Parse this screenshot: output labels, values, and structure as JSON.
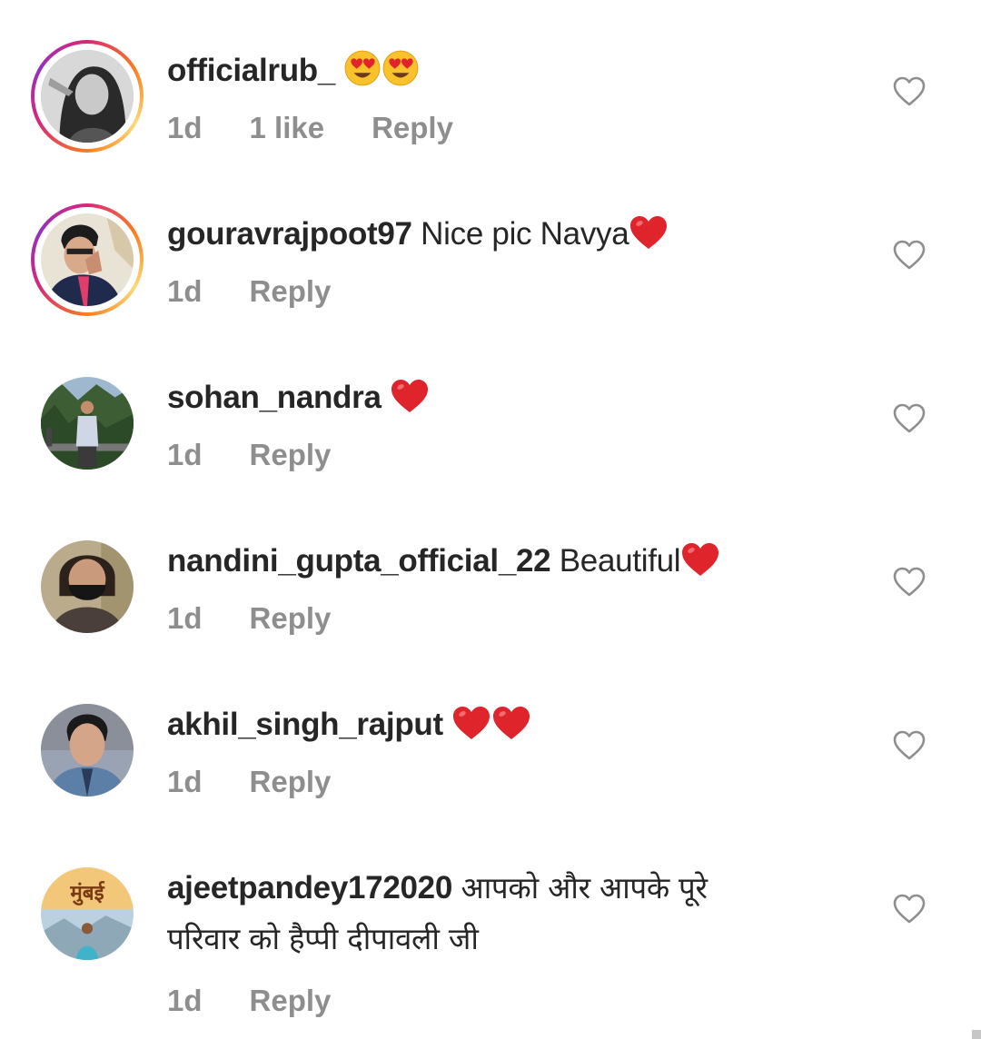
{
  "comments": [
    {
      "username": "officialrub_",
      "text": "",
      "emojis": [
        "heart-eyes",
        "heart-eyes"
      ],
      "time": "1d",
      "likes": "1 like",
      "reply": "Reply",
      "has_story_ring": true
    },
    {
      "username": "gouravrajpoot97",
      "text": "Nice pic Navya",
      "emojis": [
        "red-heart"
      ],
      "time": "1d",
      "likes": "",
      "reply": "Reply",
      "has_story_ring": true
    },
    {
      "username": "sohan_nandra",
      "text": "",
      "emojis": [
        "red-heart"
      ],
      "time": "1d",
      "likes": "",
      "reply": "Reply",
      "has_story_ring": false
    },
    {
      "username": "nandini_gupta_official_22",
      "text": "Beautiful",
      "emojis": [
        "red-heart"
      ],
      "time": "1d",
      "likes": "",
      "reply": "Reply",
      "has_story_ring": false
    },
    {
      "username": "akhil_singh_rajput",
      "text": "",
      "emojis": [
        "red-heart",
        "red-heart"
      ],
      "time": "1d",
      "likes": "",
      "reply": "Reply",
      "has_story_ring": false
    },
    {
      "username": "ajeetpandey172020",
      "text": "आपको और आपके पूरे",
      "text_line2": "परिवार को हैप्पी दीपावली जी",
      "emojis": [],
      "time": "1d",
      "likes": "",
      "reply": "Reply",
      "has_story_ring": false,
      "avatar_caption": "मुंबई"
    }
  ],
  "colors": {
    "text": "#262626",
    "meta": "#8e8e8e",
    "heart_outline": "#8e8e8e",
    "emoji_red": "#e0242b"
  },
  "icons": {
    "like_button": "heart-outline-icon",
    "red_heart": "red-heart-emoji",
    "heart_eyes": "heart-eyes-emoji"
  }
}
